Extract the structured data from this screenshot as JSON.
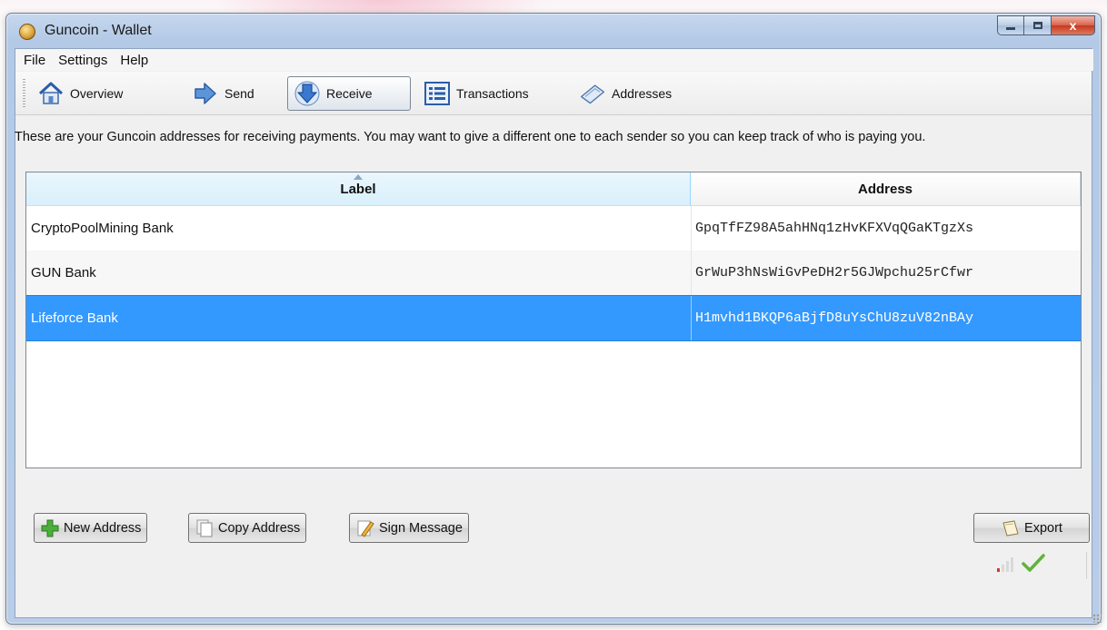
{
  "window": {
    "title": "Guncoin - Wallet",
    "close_glyph": "x"
  },
  "menu": [
    "File",
    "Settings",
    "Help"
  ],
  "toolbar": {
    "overview": "Overview",
    "send": "Send",
    "receive": "Receive",
    "transactions": "Transactions",
    "addresses": "Addresses",
    "active": "receive"
  },
  "description": "These are your Guncoin addresses for receiving payments. You may want to give a different one to each sender so you can keep track of who is paying you.",
  "table": {
    "columns": [
      "Label",
      "Address"
    ],
    "sorted_column": "Label",
    "rows": [
      {
        "label": "CryptoPoolMining Bank",
        "address": "GpqTfFZ98A5ahHNq1zHvKFXVqQGaKTgzXs"
      },
      {
        "label": "GUN Bank",
        "address": "GrWuP3hNsWiGvPeDH2r5GJWpchu25rCfwr"
      },
      {
        "label": "Lifeforce Bank",
        "address": "H1mvhd1BKQP6aBjfD8uYsChU8zuV82nBAy"
      }
    ],
    "selected_row": 2
  },
  "buttons": {
    "new_address": "New Address",
    "copy_address": "Copy Address",
    "sign_message": "Sign Message",
    "export": "Export"
  },
  "icons": {
    "overview": "house-icon",
    "send": "arrow-right-icon",
    "receive": "arrow-down-icon",
    "transactions": "list-icon",
    "addresses": "address-book-icon",
    "new_address": "plus-icon",
    "copy_address": "copy-icon",
    "sign_message": "pen-icon",
    "export": "export-icon",
    "network": "signal-bars-icon",
    "sync": "checkmark-icon"
  },
  "colors": {
    "selection": "#3399ff",
    "header_sorted": "#d9f0fc",
    "checkmark": "#5fb33a"
  }
}
